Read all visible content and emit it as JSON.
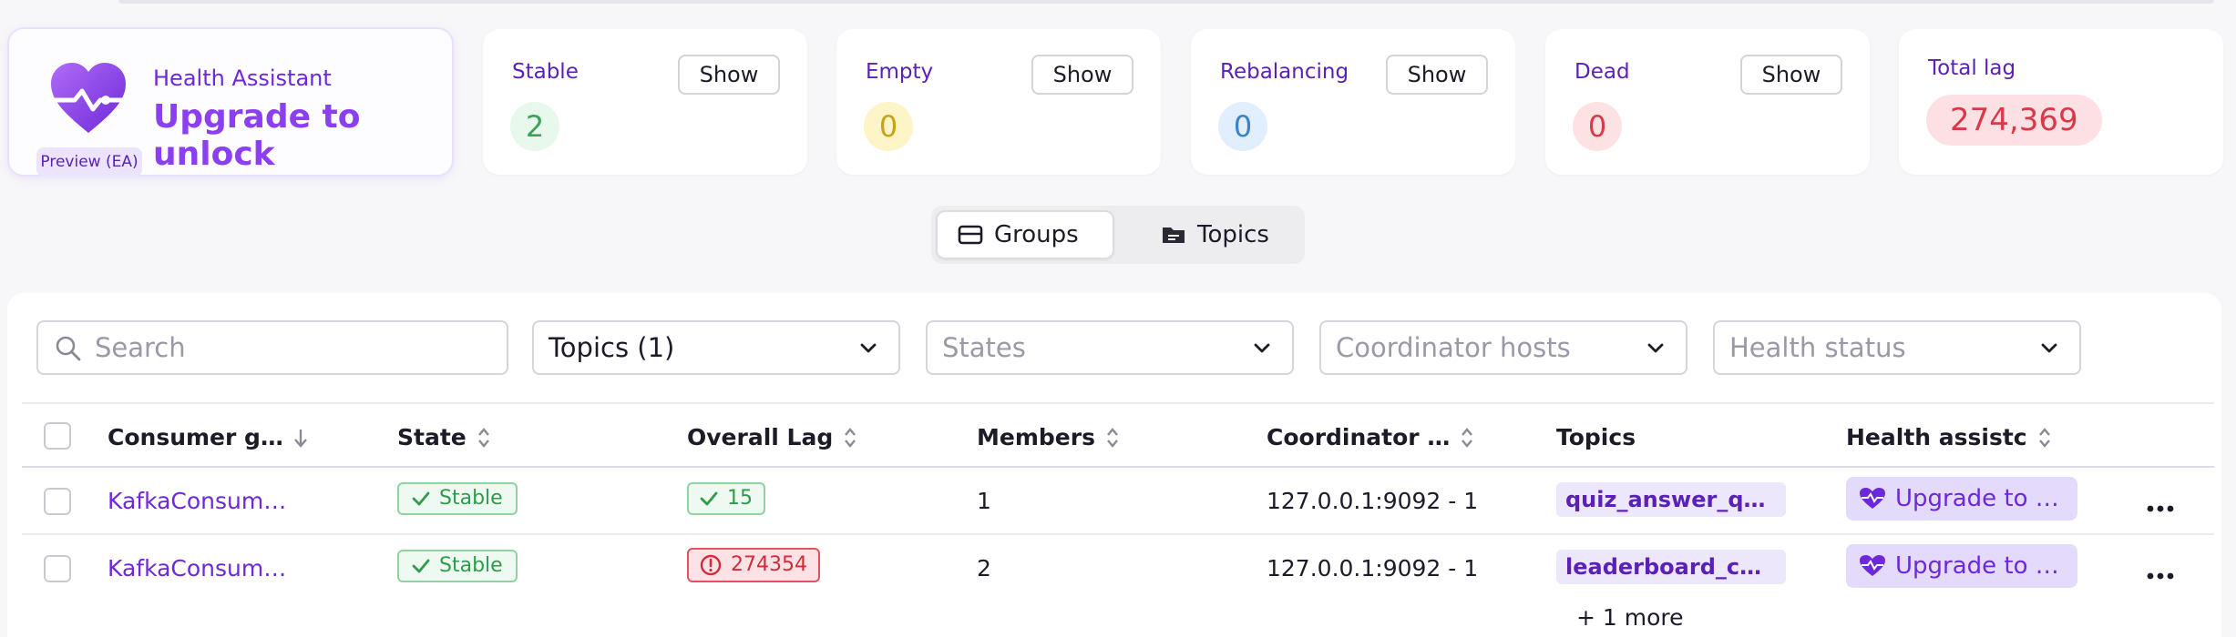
{
  "health": {
    "label": "Health Assistant",
    "upgrade": "Upgrade to unlock",
    "badge": "Preview (EA)"
  },
  "stats": [
    {
      "label": "Stable",
      "count": "2",
      "button": "Show",
      "color": "green"
    },
    {
      "label": "Empty",
      "count": "0",
      "button": "Show",
      "color": "yellow"
    },
    {
      "label": "Rebalancing",
      "count": "0",
      "button": "Show",
      "color": "blue"
    },
    {
      "label": "Dead",
      "count": "0",
      "button": "Show",
      "color": "red"
    }
  ],
  "total_lag": {
    "label": "Total lag",
    "value": "274,369"
  },
  "toggle": {
    "groups": "Groups",
    "topics": "Topics",
    "active": "groups"
  },
  "filters": {
    "search_placeholder": "Search",
    "topics_value": "Topics (1)",
    "states_placeholder": "States",
    "coordinator_placeholder": "Coordinator hosts",
    "health_placeholder": "Health status"
  },
  "table": {
    "columns": [
      "Consumer g…",
      "State",
      "Overall Lag",
      "Members",
      "Coordinator …",
      "Topics",
      "Health assistc"
    ],
    "rows": [
      {
        "group": "KafkaConsum…",
        "state": "Stable",
        "lag": "15",
        "lag_status": "ok",
        "members": "1",
        "coordinator": "127.0.0.1:9092 - 1",
        "topic": "quiz_answer_que…",
        "health": "Upgrade to …"
      },
      {
        "group": "KafkaConsum…",
        "state": "Stable",
        "lag": "274354",
        "lag_status": "high",
        "members": "2",
        "coordinator": "127.0.0.1:9092 - 1",
        "topic": "leaderboard_cha…",
        "more_topics": "+ 1 more",
        "health": "Upgrade to …"
      }
    ]
  },
  "colors": {
    "accent": "#6d28d9",
    "stable_green": "#2f9b4d",
    "lag_red": "#d83a48"
  }
}
